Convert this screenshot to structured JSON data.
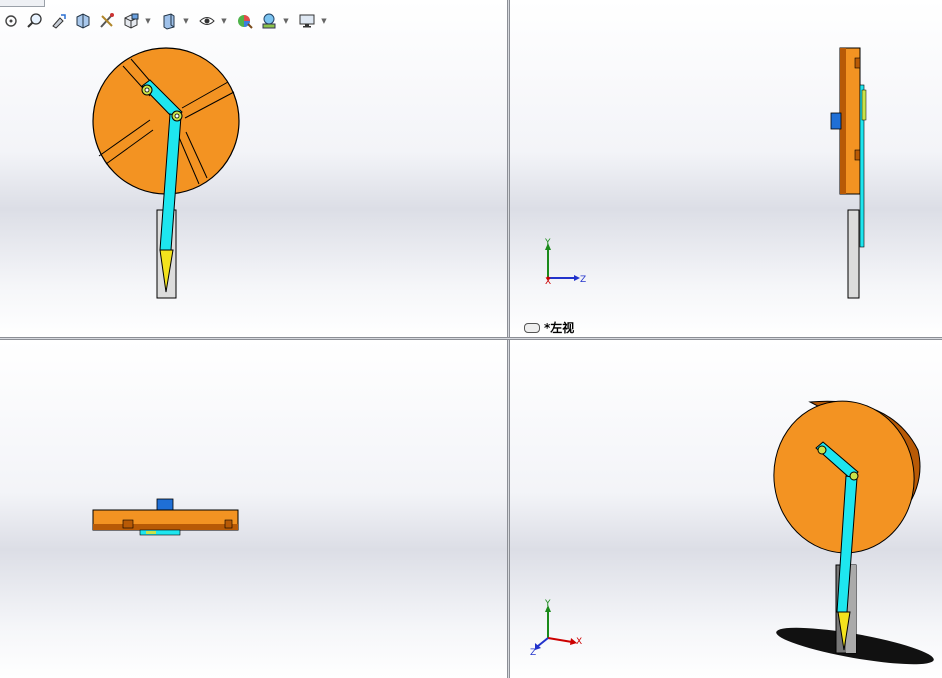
{
  "toolbar": {
    "items": [
      {
        "name": "zoom-to-fit-icon",
        "dropdown": false
      },
      {
        "name": "zoom-to-area-icon",
        "dropdown": false
      },
      {
        "name": "previous-view-icon",
        "dropdown": false
      },
      {
        "name": "section-view-icon",
        "dropdown": false
      },
      {
        "name": "dynamic-annotation-icon",
        "dropdown": false
      },
      {
        "name": "view-orientation-icon",
        "dropdown": true
      },
      {
        "name": "display-style-icon",
        "dropdown": true
      },
      {
        "name": "hide-show-items-icon",
        "dropdown": true
      },
      {
        "name": "edit-appearance-icon",
        "dropdown": false
      },
      {
        "name": "apply-scene-icon",
        "dropdown": true
      },
      {
        "name": "view-settings-icon",
        "dropdown": true
      }
    ]
  },
  "viewports": {
    "front": {
      "label": ""
    },
    "left": {
      "label": "*左视"
    },
    "top": {
      "label": ""
    },
    "iso": {
      "label": ""
    }
  },
  "triad": {
    "x": "X",
    "y": "Y",
    "z": "Z"
  },
  "colors": {
    "disc": "#f39322",
    "disc_dark": "#b85a06",
    "arm": "#1ee6ef",
    "arm_dark": "#0aa3ad",
    "joint": "#c8e34a",
    "tip": "#f3e21d",
    "hub": "#1f6fd6",
    "stem": "#dcdcdc"
  }
}
